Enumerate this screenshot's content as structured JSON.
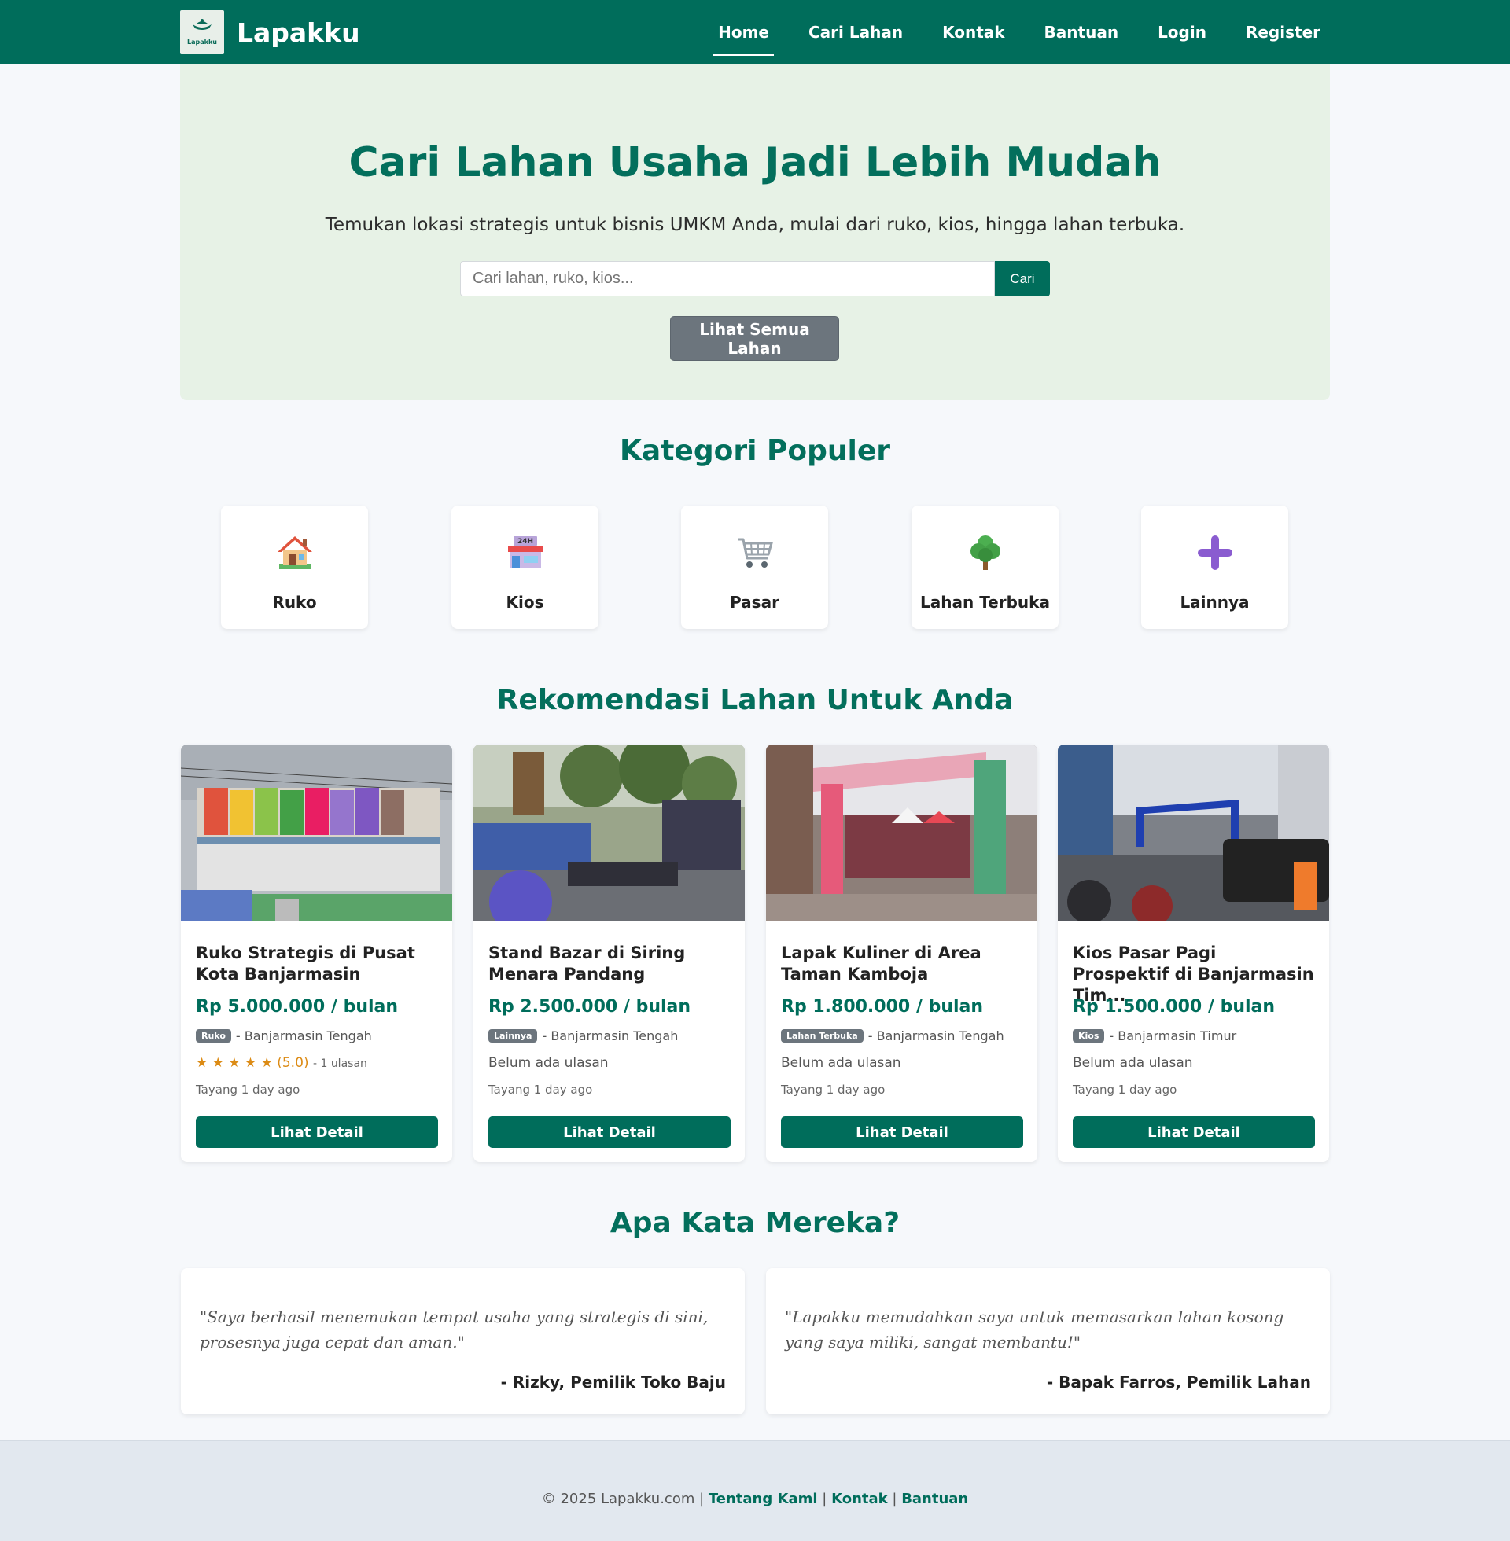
{
  "nav": {
    "brand": "Lapakku",
    "logo_text": "Lapakku",
    "items": [
      {
        "label": "Home",
        "active": true
      },
      {
        "label": "Cari Lahan",
        "active": false
      },
      {
        "label": "Kontak",
        "active": false
      },
      {
        "label": "Bantuan",
        "active": false
      },
      {
        "label": "Login",
        "active": false
      },
      {
        "label": "Register",
        "active": false
      }
    ]
  },
  "hero": {
    "title": "Cari Lahan Usaha Jadi Lebih Mudah",
    "subtitle": "Temukan lokasi strategis untuk bisnis UMKM Anda, mulai dari ruko, kios, hingga lahan terbuka.",
    "search_placeholder": "Cari lahan, ruko, kios...",
    "search_button": "Cari",
    "all_button": "Lihat Semua Lahan"
  },
  "categories": {
    "title": "Kategori Populer",
    "items": [
      {
        "label": "Ruko",
        "icon": "house-icon"
      },
      {
        "label": "Kios",
        "icon": "store-24h-icon"
      },
      {
        "label": "Pasar",
        "icon": "shopping-cart-icon"
      },
      {
        "label": "Lahan Terbuka",
        "icon": "tree-icon"
      },
      {
        "label": "Lainnya",
        "icon": "plus-icon"
      }
    ]
  },
  "listings": {
    "title": "Rekomendasi Lahan Untuk Anda",
    "items": [
      {
        "title": "Ruko Strategis di Pusat Kota Banjarmasin",
        "price": "Rp 5.000.000 / bulan",
        "badge": "Ruko",
        "location": "- Banjarmasin Tengah",
        "stars": "★ ★ ★ ★ ★",
        "rating": "(5.0)",
        "review_count": "- 1 ulasan",
        "no_review": "",
        "posted": "Tayang 1 day ago",
        "button": "Lihat Detail"
      },
      {
        "title": "Stand Bazar di Siring Menara Pandang",
        "price": "Rp 2.500.000 / bulan",
        "badge": "Lainnya",
        "location": "- Banjarmasin Tengah",
        "stars": "",
        "rating": "",
        "review_count": "",
        "no_review": "Belum ada ulasan",
        "posted": "Tayang 1 day ago",
        "button": "Lihat Detail"
      },
      {
        "title": "Lapak Kuliner di Area Taman Kamboja",
        "price": "Rp 1.800.000 / bulan",
        "badge": "Lahan Terbuka",
        "location": "- Banjarmasin Tengah",
        "stars": "",
        "rating": "",
        "review_count": "",
        "no_review": "Belum ada ulasan",
        "posted": "Tayang 1 day ago",
        "button": "Lihat Detail"
      },
      {
        "title": "Kios Pasar Pagi Prospektif di Banjarmasin Tim...",
        "price": "Rp 1.500.000 / bulan",
        "badge": "Kios",
        "location": "- Banjarmasin Timur",
        "stars": "",
        "rating": "",
        "review_count": "",
        "no_review": "Belum ada ulasan",
        "posted": "Tayang 1 day ago",
        "button": "Lihat Detail"
      }
    ]
  },
  "testimonials": {
    "title": "Apa Kata Mereka?",
    "items": [
      {
        "quote": "\"Saya berhasil menemukan tempat usaha yang strategis di sini, prosesnya juga cepat dan aman.\"",
        "author": "- Rizky, Pemilik Toko Baju"
      },
      {
        "quote": "\"Lapakku memudahkan saya untuk memasarkan lahan kosong yang saya miliki, sangat membantu!\"",
        "author": "- Bapak Farros, Pemilik Lahan"
      }
    ]
  },
  "footer": {
    "copyright": "© 2025 Lapakku.com |",
    "links": [
      "Tentang Kami",
      "Kontak",
      "Bantuan"
    ],
    "separator": "|"
  },
  "colors": {
    "primary": "#006d5b",
    "hero_bg": "#e7f2e6",
    "secondary_button": "#6c757d",
    "star": "#dc8b15"
  }
}
